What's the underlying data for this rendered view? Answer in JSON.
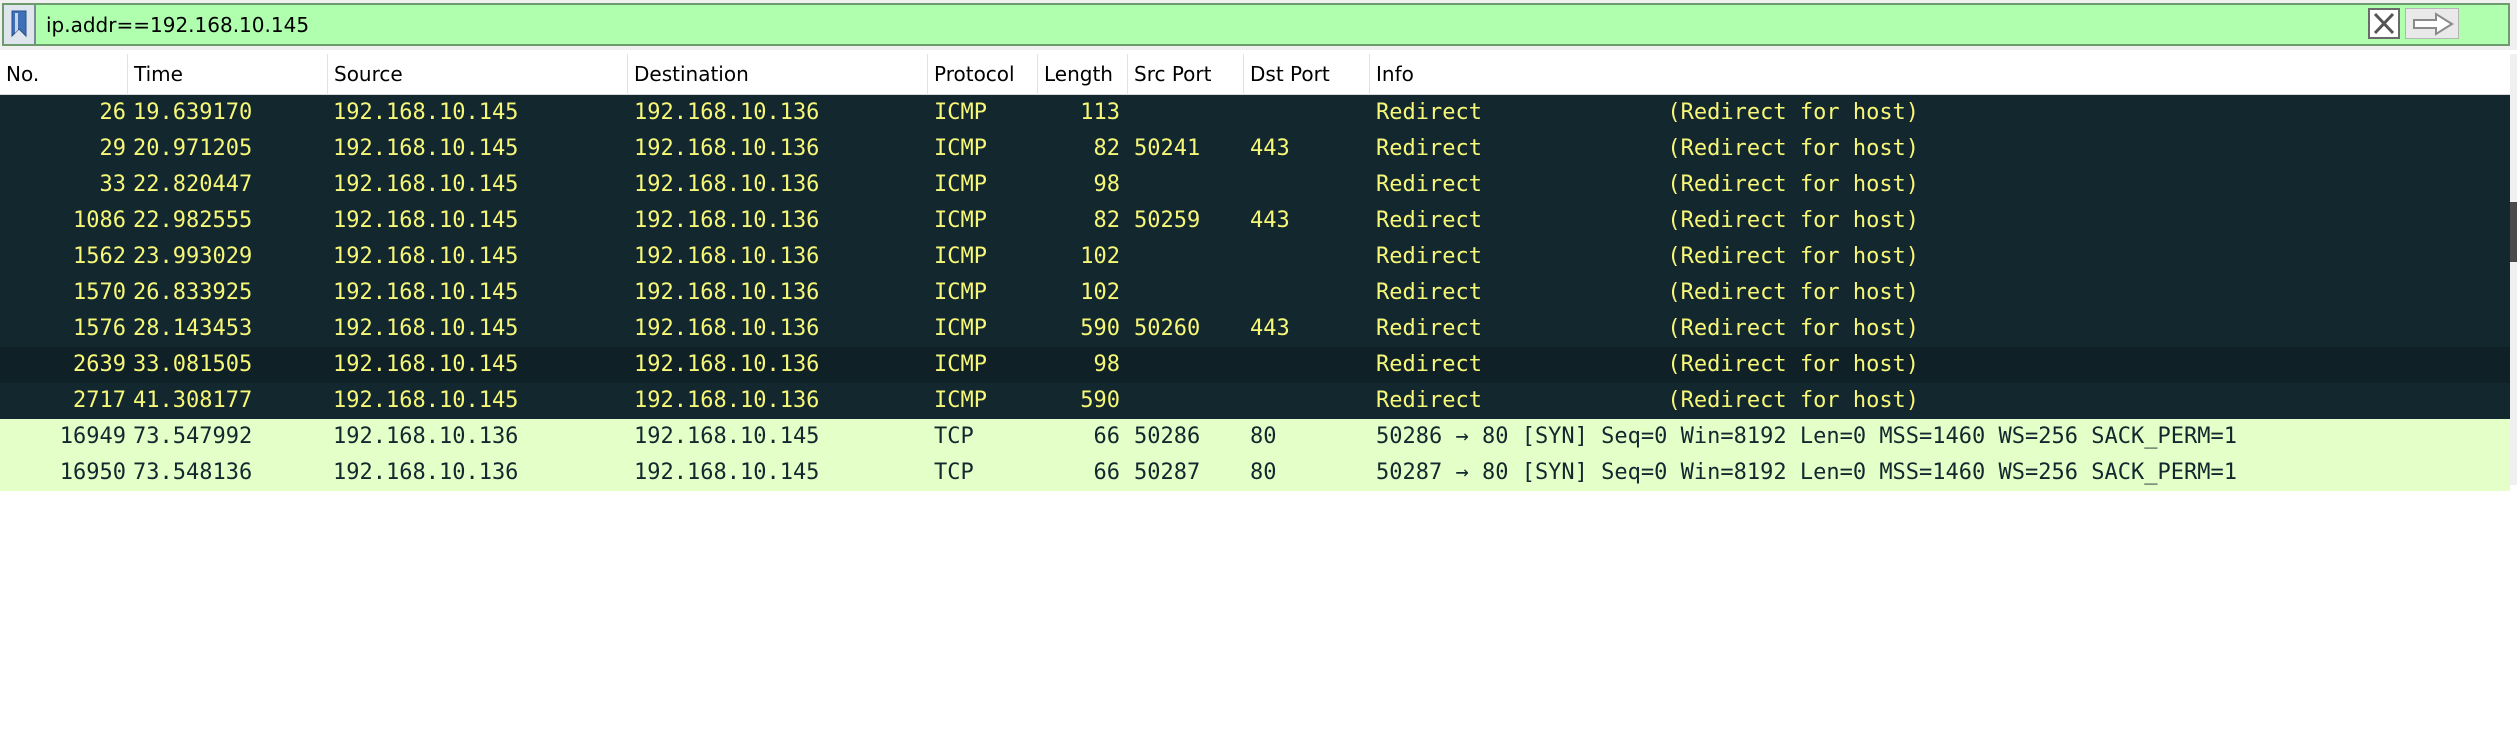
{
  "filter": {
    "value": "ip.addr==192.168.10.145",
    "bookmark_icon": "bookmark-icon",
    "clear_icon": "clear-x-icon",
    "apply_icon": "arrow-right-icon",
    "field_color": "#afffaf"
  },
  "columns": [
    "No.",
    "Time",
    "Source",
    "Destination",
    "Protocol",
    "Length",
    "Src Port",
    "Dst Port",
    "Info"
  ],
  "colors": {
    "icmp_bg": "#12272e",
    "icmp_fg": "#f7f778",
    "tcp_bg": "#e4ffc7",
    "tcp_fg": "#12272e"
  },
  "packets": [
    {
      "no": "26",
      "time": "19.639170",
      "src": "192.168.10.145",
      "dst": "192.168.10.136",
      "proto": "ICMP",
      "len": "113",
      "sport": "",
      "dport": "",
      "info": "Redirect              (Redirect for host)",
      "style": "dark"
    },
    {
      "no": "29",
      "time": "20.971205",
      "src": "192.168.10.145",
      "dst": "192.168.10.136",
      "proto": "ICMP",
      "len": "82",
      "sport": "50241",
      "dport": "443",
      "info": "Redirect              (Redirect for host)",
      "style": "dark"
    },
    {
      "no": "33",
      "time": "22.820447",
      "src": "192.168.10.145",
      "dst": "192.168.10.136",
      "proto": "ICMP",
      "len": "98",
      "sport": "",
      "dport": "",
      "info": "Redirect              (Redirect for host)",
      "style": "dark"
    },
    {
      "no": "1086",
      "time": "22.982555",
      "src": "192.168.10.145",
      "dst": "192.168.10.136",
      "proto": "ICMP",
      "len": "82",
      "sport": "50259",
      "dport": "443",
      "info": "Redirect              (Redirect for host)",
      "style": "dark"
    },
    {
      "no": "1562",
      "time": "23.993029",
      "src": "192.168.10.145",
      "dst": "192.168.10.136",
      "proto": "ICMP",
      "len": "102",
      "sport": "",
      "dport": "",
      "info": "Redirect              (Redirect for host)",
      "style": "dark"
    },
    {
      "no": "1570",
      "time": "26.833925",
      "src": "192.168.10.145",
      "dst": "192.168.10.136",
      "proto": "ICMP",
      "len": "102",
      "sport": "",
      "dport": "",
      "info": "Redirect              (Redirect for host)",
      "style": "dark"
    },
    {
      "no": "1576",
      "time": "28.143453",
      "src": "192.168.10.145",
      "dst": "192.168.10.136",
      "proto": "ICMP",
      "len": "590",
      "sport": "50260",
      "dport": "443",
      "info": "Redirect              (Redirect for host)",
      "style": "dark"
    },
    {
      "no": "2639",
      "time": "33.081505",
      "src": "192.168.10.145",
      "dst": "192.168.10.136",
      "proto": "ICMP",
      "len": "98",
      "sport": "",
      "dport": "",
      "info": "Redirect              (Redirect for host)",
      "style": "dark alt"
    },
    {
      "no": "2717",
      "time": "41.308177",
      "src": "192.168.10.145",
      "dst": "192.168.10.136",
      "proto": "ICMP",
      "len": "590",
      "sport": "",
      "dport": "",
      "info": "Redirect              (Redirect for host)",
      "style": "dark"
    },
    {
      "no": "16949",
      "time": "73.547992",
      "src": "192.168.10.136",
      "dst": "192.168.10.145",
      "proto": "TCP",
      "len": "66",
      "sport": "50286",
      "dport": "80",
      "info": "50286 → 80 [SYN] Seq=0 Win=8192 Len=0 MSS=1460 WS=256 SACK_PERM=1",
      "style": "light"
    },
    {
      "no": "16950",
      "time": "73.548136",
      "src": "192.168.10.136",
      "dst": "192.168.10.145",
      "proto": "TCP",
      "len": "66",
      "sport": "50287",
      "dport": "80",
      "info": "50287 → 80 [SYN] Seq=0 Win=8192 Len=0 MSS=1460 WS=256 SACK_PERM=1",
      "style": "light"
    }
  ]
}
